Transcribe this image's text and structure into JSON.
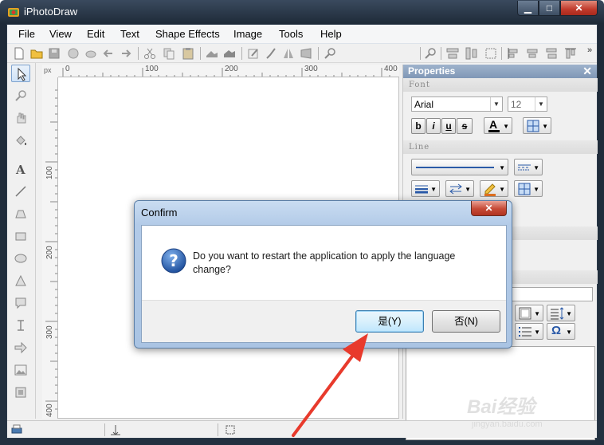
{
  "window": {
    "title": "iPhotoDraw",
    "min_glyph": "▁",
    "max_glyph": "□",
    "close_glyph": "✕"
  },
  "menu": [
    "File",
    "View",
    "Edit",
    "Text",
    "Shape Effects",
    "Image",
    "Tools",
    "Help"
  ],
  "toolbar": {
    "overflow": "»"
  },
  "ruler": {
    "unit": "px",
    "h_ticks": [
      "0",
      "100",
      "200",
      "300",
      "400"
    ],
    "v_ticks": [
      "100",
      "200",
      "300",
      "400"
    ]
  },
  "properties": {
    "title": "Properties",
    "close_glyph": "✕",
    "font_section": "Font",
    "font_name": "Arial",
    "font_size": "12",
    "bold": "b",
    "italic": "i",
    "underline": "u",
    "strike": "s",
    "font_color_letter": "A",
    "line_section": "Line",
    "omega": "Ω"
  },
  "dialog": {
    "title": "Confirm",
    "close_glyph": "✕",
    "message": "Do you want to restart the application to apply the language change?",
    "yes_label": "是(Y)",
    "no_label": "否(N)"
  },
  "watermark": {
    "logo": "Bai经验",
    "url": "jingyan.baidu.com"
  },
  "colors": {
    "title_bar": "#1e2a38",
    "dialog_frame": "#b3cbe8",
    "default_button": "#3c7fb1",
    "annotation_arrow": "#e83a2c",
    "question_icon": "#2a5aa8"
  }
}
